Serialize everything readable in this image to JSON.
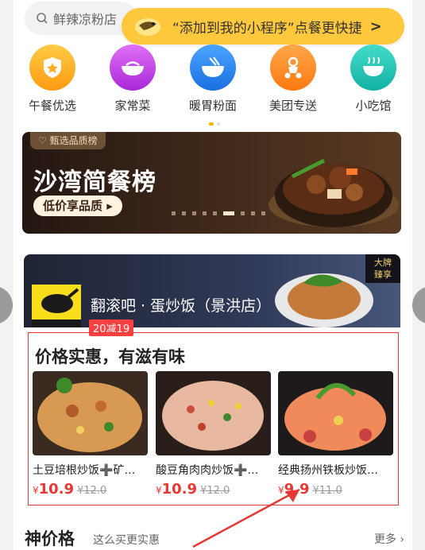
{
  "search": {
    "text": "鲜辣凉粉店"
  },
  "mini_program_tip": {
    "text": "“添加到我的小程序”点餐更快捷",
    "icon": "chevron-right-icon"
  },
  "categories": [
    {
      "label": "午餐优选",
      "icon": "shield-star-icon",
      "color": "#ffae1a"
    },
    {
      "label": "家常菜",
      "icon": "dish-bowl-icon",
      "color": "#c040e0"
    },
    {
      "label": "暖胃粉面",
      "icon": "noodle-bowl-icon",
      "color": "#2d86f0"
    },
    {
      "label": "美团专送",
      "icon": "scooter-icon",
      "color": "#ff8a1a"
    },
    {
      "label": "小吃馆",
      "icon": "snack-bowl-icon",
      "color": "#21c8b8"
    }
  ],
  "banner": {
    "tag": "甄选品质榜",
    "title": "沙湾简餐榜",
    "button": "低价享品质"
  },
  "restaurant": {
    "name": "翻滚吧 · 蛋炒饭（景洪店）",
    "discount": "20减19",
    "badge_line1": "大牌",
    "badge_line2": "臻享"
  },
  "promo": {
    "title": "价格实惠，有滋有味",
    "items": [
      {
        "title": "土豆培根炒饭➕矿…",
        "currency": "¥",
        "price": "10.9",
        "original": "¥12.0"
      },
      {
        "title": "酸豆角肉肉炒饭➕…",
        "currency": "¥",
        "price": "10.9",
        "original": "¥12.0"
      },
      {
        "title": "经典扬州铁板炒饭…",
        "currency": "¥",
        "price": "9.9",
        "original": "¥11.0"
      }
    ]
  },
  "section": {
    "title": "神价格",
    "subtitle": "这么买更实惠",
    "more": "更多"
  },
  "colors": {
    "accent": "#ffc83d",
    "price": "#e53935",
    "discount": "#ff4040"
  }
}
